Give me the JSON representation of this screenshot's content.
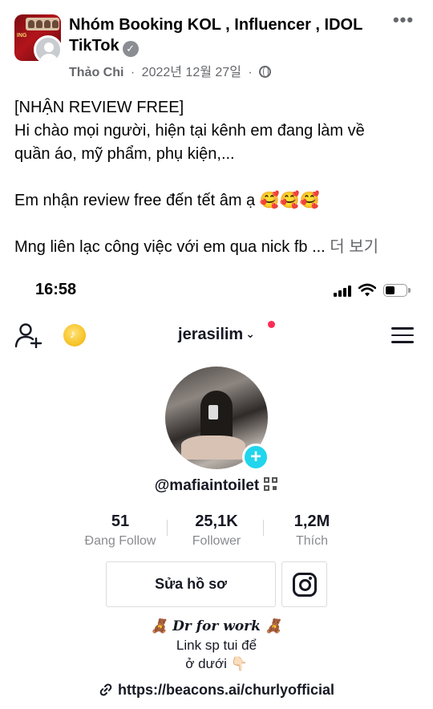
{
  "post": {
    "group_name": "Nhóm Booking KOL , Influencer , IDOL TikTok",
    "group_avatar_text": "ING",
    "author": "Thảo Chi",
    "date": "2022년 12월 27일",
    "separator": "·",
    "more_icon": "more-dots-icon",
    "privacy_icon": "globe-icon",
    "text_lines": [
      "[NHẬN REVIEW FREE]",
      "Hi chào mọi người, hiện tại kênh em đang làm về",
      "quần áo, mỹ phẩm, phụ kiện,...",
      "",
      "Em nhận review free đến tết âm ạ 🥰🥰🥰",
      "",
      "Mng liên lạc công việc với em qua nick fb ..."
    ],
    "see_more": "더 보기"
  },
  "tiktok": {
    "status_bar": {
      "time": "16:58"
    },
    "nav": {
      "username": "jerasilim",
      "chevron": "⌄"
    },
    "handle": "@mafiaintoilet",
    "stats": [
      {
        "value": "51",
        "label": "Đang Follow"
      },
      {
        "value": "25,1K",
        "label": "Follower"
      },
      {
        "value": "1,2M",
        "label": "Thích"
      }
    ],
    "edit_profile_label": "Sửa hồ sơ",
    "bio": {
      "line1": "🧸 Dr for work 🧸",
      "line2": "Link sp tui để",
      "line3": "ở dưới 👇🏻"
    },
    "link": "https://beacons.ai/churlyofficial",
    "colors": {
      "accent": "#fe2c55",
      "add_button": "#20d5ec",
      "coin": "#f7c52b"
    }
  }
}
